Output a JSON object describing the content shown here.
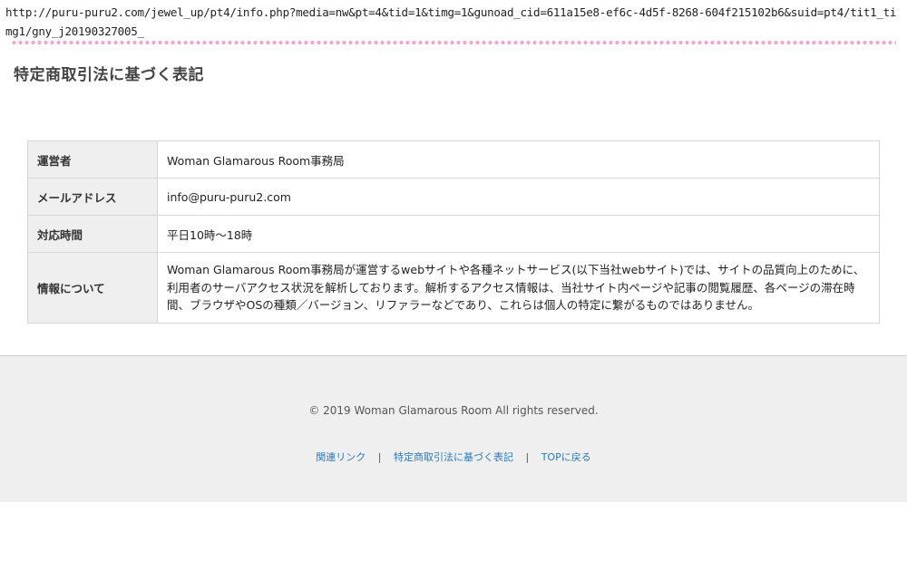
{
  "url": "http://puru-puru2.com/jewel_up/pt4/info.php?media=nw&pt=4&tid=1&timg=1&gunoad_cid=611a15e8-ef6c-4d5f-8268-604f215102b6&suid=pt4/tit1_timg1/gny_j20190327005_",
  "page_title": "特定商取引法に基づく表記",
  "table": {
    "rows": [
      {
        "label": "運営者",
        "value": "Woman Glamarous Room事務局"
      },
      {
        "label": "メールアドレス",
        "value": "info@puru-puru2.com"
      },
      {
        "label": "対応時間",
        "value": "平日10時～18時"
      },
      {
        "label": "情報について",
        "value": "Woman Glamarous Room事務局が運営するwebサイトや各種ネットサービス(以下当社webサイト)では、サイトの品質向上のために、利用者のサーバアクセス状況を解析しております。解析するアクセス情報は、当社サイト内ページや記事の閲覧履歴、各ページの滞在時間、ブラウザやOSの種類／バージョン、リファラーなどであり、これらは個人の特定に繋がるものではありません。"
      }
    ]
  },
  "footer": {
    "copyright": "© 2019 Woman Glamarous Room All rights reserved.",
    "links": [
      "関連リンク",
      "特定商取引法に基づく表記",
      "TOPに戻る"
    ],
    "separator": "|",
    "link_color": "#2a7bbf",
    "background": "#efefef"
  },
  "divider_color": "#f4a6cf"
}
